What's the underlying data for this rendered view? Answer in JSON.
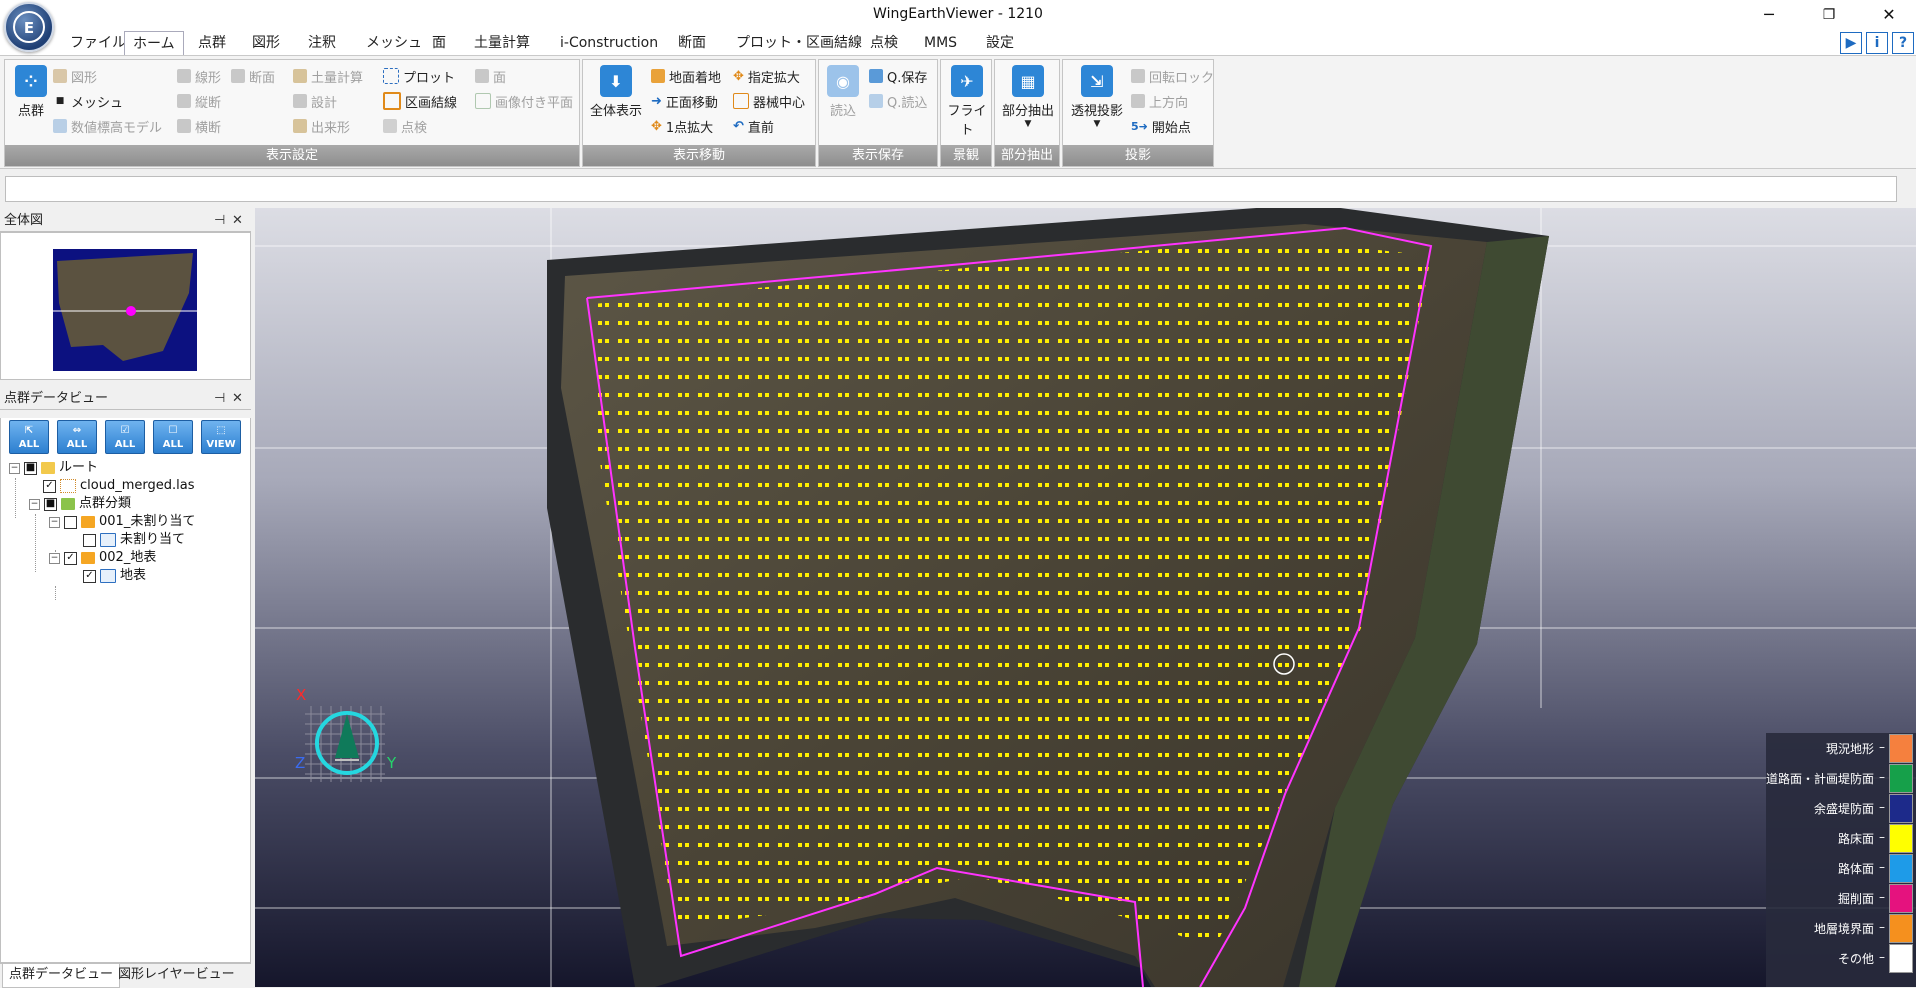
{
  "window": {
    "title": "WingEarthViewer - 1210",
    "minimize": "─",
    "restore": "❐",
    "close": "✕"
  },
  "menu": {
    "tabs": [
      "ファイル",
      "ホーム",
      "点群",
      "図形",
      "注釈",
      "メッシュ",
      "面",
      "土量計算",
      "i-Construction",
      "断面",
      "プロット・区画結線",
      "点検",
      "MMS",
      "設定"
    ],
    "active": "ホーム"
  },
  "help_icons": [
    "▶",
    "i",
    "?"
  ],
  "ribbon": {
    "display": {
      "label": "表示設定",
      "big": "点群",
      "items": {
        "figure": "図形",
        "mesh": "メッシュ",
        "dem": "数値標高モデル",
        "polyline": "線形",
        "section": "断面",
        "longitudinal": "縦断",
        "cross": "横断",
        "earthwork": "土量計算",
        "design": "設計",
        "asbuilt": "出来形",
        "plot": "プロット",
        "parcel": "区画結線",
        "inspect": "点検",
        "surface": "面",
        "image_plane": "画像付き平面"
      }
    },
    "move": {
      "label": "表示移動",
      "big": "全体表示",
      "items": {
        "ground": "地面着地",
        "front": "正面移動",
        "onept": "1点拡大",
        "zoom_specified": "指定拡大",
        "instrument_center": "器械中心",
        "previous": "直前"
      }
    },
    "save": {
      "label": "表示保存",
      "big": "読込",
      "items": {
        "qsave": "Q.保存",
        "qload": "Q.読込"
      }
    },
    "scene": {
      "label": "景観",
      "big": "フライト"
    },
    "extract": {
      "label": "部分抽出",
      "big": "部分抽出"
    },
    "projection": {
      "label": "投影",
      "big": "透視投影",
      "items": {
        "rotate_lock": "回転ロック",
        "up": "上方向",
        "start": "開始点"
      }
    }
  },
  "panels": {
    "overview": {
      "title": "全体図",
      "pin": "⊣",
      "close": "✕"
    },
    "clouddata": {
      "title": "点群データビュー",
      "pin": "⊣",
      "close": "✕",
      "toolbar": [
        "ALL",
        "ALL",
        "ALL",
        "ALL",
        "VIEW"
      ]
    }
  },
  "tree": {
    "root": "ルート",
    "file": "cloud_merged.las",
    "classification": "点群分類",
    "class1": "001_未割り当て",
    "class1_child": "未割り当て",
    "class2": "002_地表",
    "class2_child": "地表"
  },
  "bottom_tabs": [
    "点群データビュー",
    "図形レイヤービュー"
  ],
  "axes": {
    "x": "X",
    "y": "Y",
    "z": "Z"
  },
  "legend": [
    {
      "label": "現況地形",
      "color": "#f5803e"
    },
    {
      "label": "道路面・計画堤防面",
      "color": "#16a04a"
    },
    {
      "label": "余盛堤防面",
      "color": "#1d2a8a"
    },
    {
      "label": "路床面",
      "color": "#ffff00"
    },
    {
      "label": "路体面",
      "color": "#1e9be8"
    },
    {
      "label": "掘削面",
      "color": "#e5127e"
    },
    {
      "label": "地層境界面",
      "color": "#f5901e"
    },
    {
      "label": "その他",
      "color": "#ffffff"
    }
  ],
  "legend_dash": "–"
}
